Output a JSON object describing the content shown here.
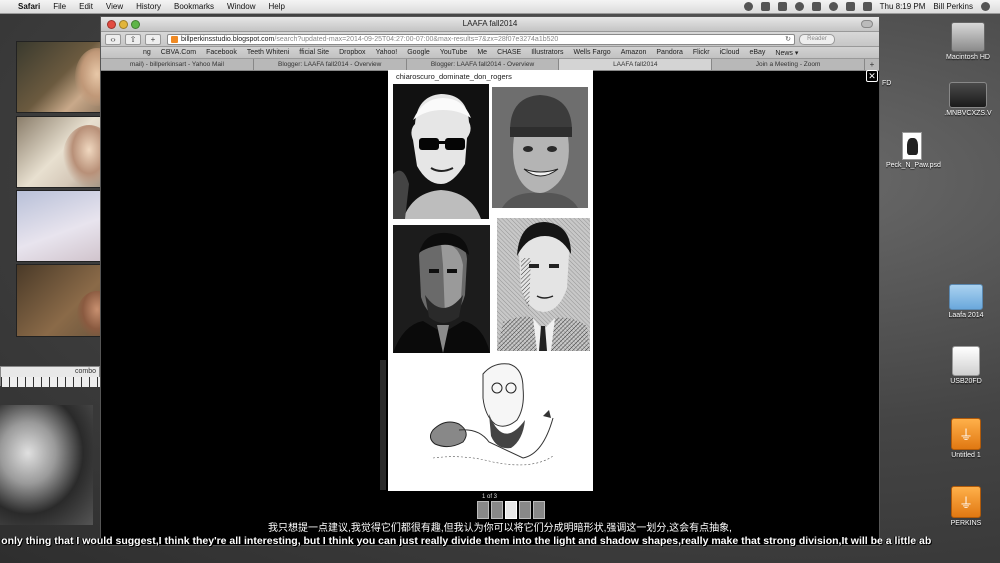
{
  "menubar": {
    "app": "Safari",
    "menus": [
      "File",
      "Edit",
      "View",
      "History",
      "Bookmarks",
      "Window",
      "Help"
    ],
    "clock": "Thu 8:19 PM",
    "user": "Bill Perkins"
  },
  "browser": {
    "window_title": "LAAFA fall2014",
    "url_domain": "billperkinsstudio.blogspot.com",
    "url_path": "/search?updated-max=2014-09-25T04:27:00-07:00&max-results=7&zx=28f07e3274a1b520",
    "reader_label": "Reader",
    "bookmarks": [
      "ng",
      "CBVA.Com",
      "Facebook",
      "Teeth Whiteni",
      "fficial Site",
      "Dropbox",
      "Yahoo!",
      "Google",
      "YouTube",
      "Me",
      "CHASE",
      "Illustrators",
      "Wells Fargo",
      "Amazon",
      "Pandora",
      "Flickr",
      "iCloud",
      "eBay",
      "News ▾"
    ],
    "tabs": [
      {
        "label": "mail) - billperkinsart - Yahoo Mail",
        "active": false
      },
      {
        "label": "Blogger: LAAFA fall2014 - Overview",
        "active": false
      },
      {
        "label": "Blogger: LAAFA fall2014 - Overview",
        "active": false
      },
      {
        "label": "LAAFA fall2014",
        "active": true
      },
      {
        "label": "Join a Meeting - Zoom",
        "active": false
      }
    ]
  },
  "lightbox": {
    "caption": "chiaroscuro_dominate_don_rogers",
    "counter": "1 of 3",
    "close_symbol": "✕"
  },
  "desktop_icons": [
    {
      "label": "Macintosh HD",
      "icon": "hard-drive-icon"
    },
    {
      "label": ".MNBVCXZS.V",
      "icon": "printer-icon"
    },
    {
      "label": "Peck_N_Paw.psd",
      "icon": "psd-file-icon"
    },
    {
      "label": "Laafa 2014",
      "icon": "folder-icon"
    },
    {
      "label": "USB20FD",
      "icon": "usb-drive-icon"
    },
    {
      "label": "Untitled 1",
      "icon": "usb-folder-icon"
    },
    {
      "label": "PERKINS",
      "icon": "usb-folder-icon"
    }
  ],
  "partial_labels": {
    "fd": "FD",
    "mini_window": "combo"
  },
  "subtitles": {
    "zh": "我只想提一点建议,我觉得它们都很有趣,但我认为你可以将它们分成明暗形状,强调这一划分,这会有点抽象,",
    "en": "he only thing that I would suggest,I think they're all interesting, but I think you can just really divide them into the light and shadow shapes,really make that strong division,It will be a little ab"
  }
}
